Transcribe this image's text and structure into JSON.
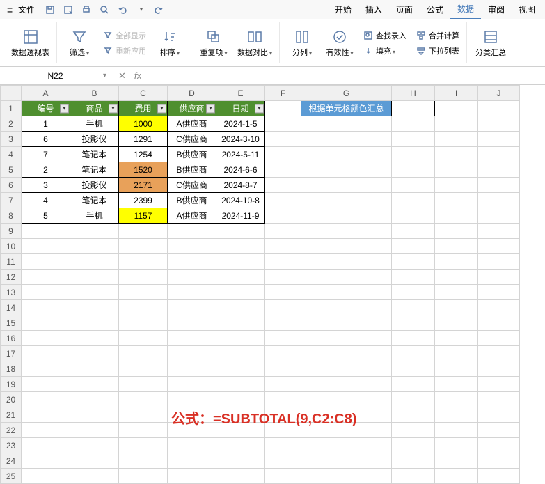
{
  "menubar": {
    "file_label": "文件",
    "tabs": [
      "开始",
      "插入",
      "页面",
      "公式",
      "数据",
      "审阅",
      "视图"
    ],
    "active_tab_index": 4
  },
  "ribbon": {
    "pivot": "数据透视表",
    "filter": "筛选",
    "show_all": "全部显示",
    "reapply": "重新应用",
    "sort": "排序",
    "duplicates": "重复项",
    "data_compare": "数据对比",
    "text_to_cols": "分列",
    "validation": "有效性",
    "find_entry": "查找录入",
    "fill": "填充",
    "consolidate": "合并计算",
    "dropdown_list": "下拉列表",
    "subtotal": "分类汇总"
  },
  "name_box": {
    "value": "N22"
  },
  "formula_bar": {
    "value": ""
  },
  "columns": [
    "A",
    "B",
    "C",
    "D",
    "E",
    "F",
    "G",
    "H",
    "I",
    "J"
  ],
  "row_count": 25,
  "headers": {
    "A": "编号",
    "B": "商品",
    "C": "费用",
    "D": "供应商",
    "E": "日期"
  },
  "note": "根据单元格颜色汇总",
  "data_rows": [
    {
      "id": "1",
      "product": "手机",
      "cost": "1000",
      "supplier": "A供应商",
      "date": "2024-1-5",
      "cost_class": "yellow-bg"
    },
    {
      "id": "6",
      "product": "投影仪",
      "cost": "1291",
      "supplier": "C供应商",
      "date": "2024-3-10",
      "cost_class": ""
    },
    {
      "id": "7",
      "product": "笔记本",
      "cost": "1254",
      "supplier": "B供应商",
      "date": "2024-5-11",
      "cost_class": ""
    },
    {
      "id": "2",
      "product": "笔记本",
      "cost": "1520",
      "supplier": "B供应商",
      "date": "2024-6-6",
      "cost_class": "orange-bg"
    },
    {
      "id": "3",
      "product": "投影仪",
      "cost": "2171",
      "supplier": "C供应商",
      "date": "2024-8-7",
      "cost_class": "orange-bg"
    },
    {
      "id": "4",
      "product": "笔记本",
      "cost": "2399",
      "supplier": "B供应商",
      "date": "2024-10-8",
      "cost_class": ""
    },
    {
      "id": "5",
      "product": "手机",
      "cost": "1157",
      "supplier": "A供应商",
      "date": "2024-11-9",
      "cost_class": "yellow-bg"
    }
  ],
  "formula_note": "公式：=SUBTOTAL(9,C2:C8)"
}
